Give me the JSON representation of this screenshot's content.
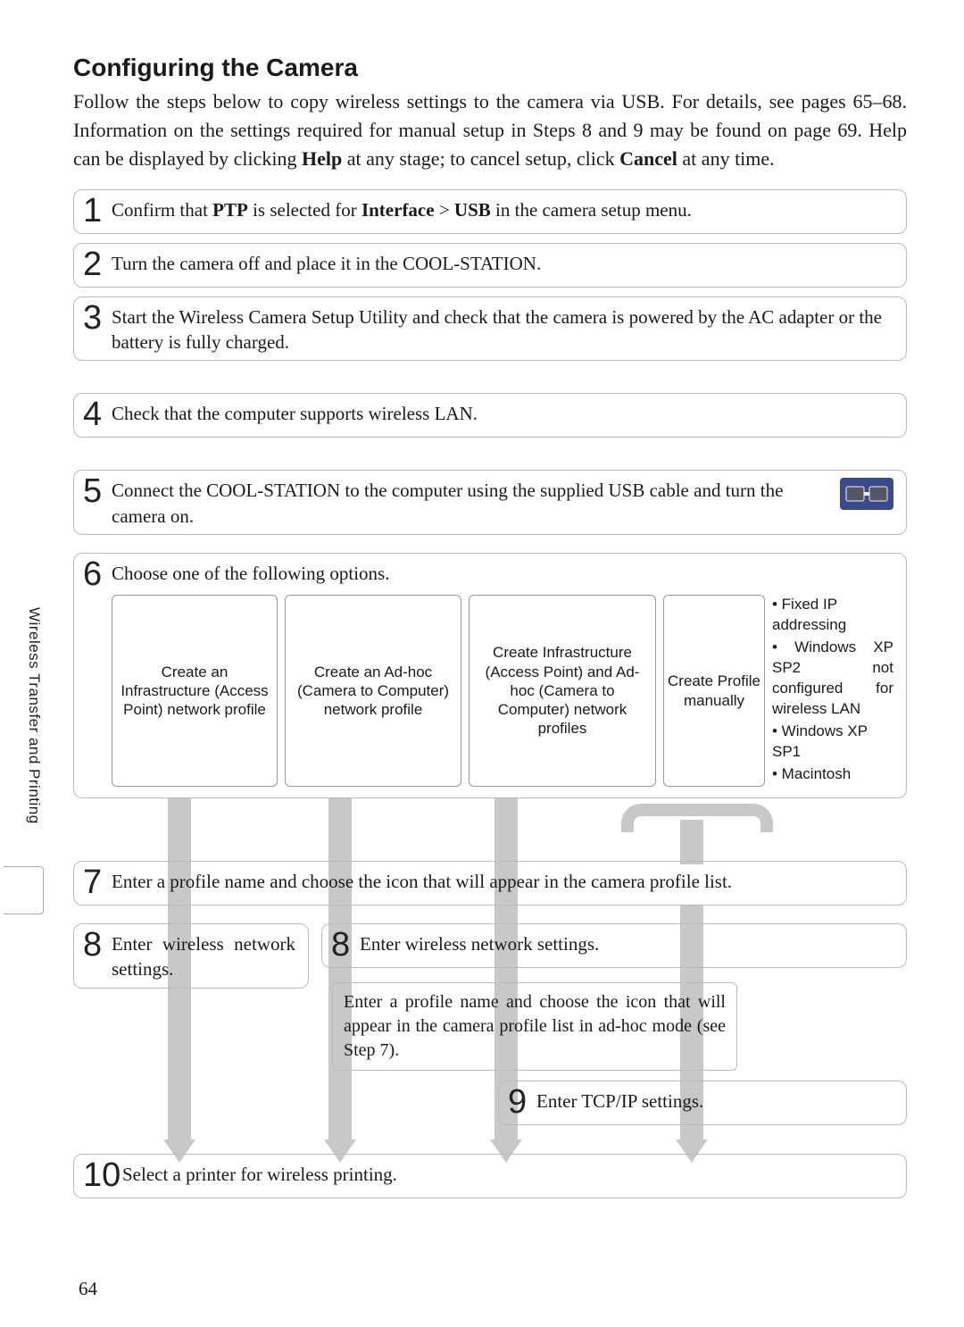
{
  "title": "Configuring the Camera",
  "intro_parts": {
    "p1": "Follow the steps below to copy wireless settings to the camera via USB.  For details, see pages 65–68.  Information on the settings required for manual setup in Steps 8 and 9 may be found on page 69.  Help can be displayed by clicking ",
    "help": "Help",
    "p2": " at any stage; to cancel setup, click ",
    "cancel": "Cancel",
    "p3": " at any time."
  },
  "steps": {
    "s1": {
      "n": "1",
      "a": "Confirm that ",
      "b": "PTP",
      "c": " is selected for ",
      "d": "Interface",
      "e": " > ",
      "f": "USB",
      "g": " in the camera setup menu."
    },
    "s2": {
      "n": "2",
      "t": "Turn the camera off and place it in the COOL-STATION."
    },
    "s3": {
      "n": "3",
      "t": "Start the Wireless Camera Setup Utility and check that the camera is powered by the AC adapter or the battery is fully charged."
    },
    "s4": {
      "n": "4",
      "t": "Check that the computer supports wireless LAN."
    },
    "s5": {
      "n": "5",
      "t": "Connect the COOL-STATION to the computer using the supplied USB  cable and turn the camera on."
    },
    "s6": {
      "n": "6",
      "t": "Choose one of the following options."
    },
    "s7": {
      "n": "7",
      "t": "Enter a profile name and choose the icon that will appear in the camera profile list."
    },
    "s8a": {
      "n": "8",
      "t": "Enter wireless network settings."
    },
    "s8b": {
      "n": "8",
      "t": "Enter wireless network settings."
    },
    "noteB": "Enter a profile name and choose the icon that will appear in the camera profile list in ad-hoc mode (see Step 7).",
    "s9": {
      "n": "9",
      "t": "Enter TCP/IP settings."
    },
    "s10": {
      "n": "10",
      "t": "Select a printer for wireless printing."
    }
  },
  "options": {
    "a": "Create an Infrastructure (Access Point) network profile",
    "b": "Create an Ad-hoc (Camera to Computer) network profile",
    "c": "Create Infrastructure (Access Point) and Ad-hoc (Camera to Computer) network profiles",
    "d": "Create Profile manually"
  },
  "sidenote": {
    "l1": "• Fixed IP addressing",
    "l2": "• Windows XP SP2 not configured for wireless LAN",
    "l3": "• Windows XP SP1",
    "l4": "• Macintosh"
  },
  "sidebar_label": "Wireless Transfer and Printing",
  "page_number": "64"
}
